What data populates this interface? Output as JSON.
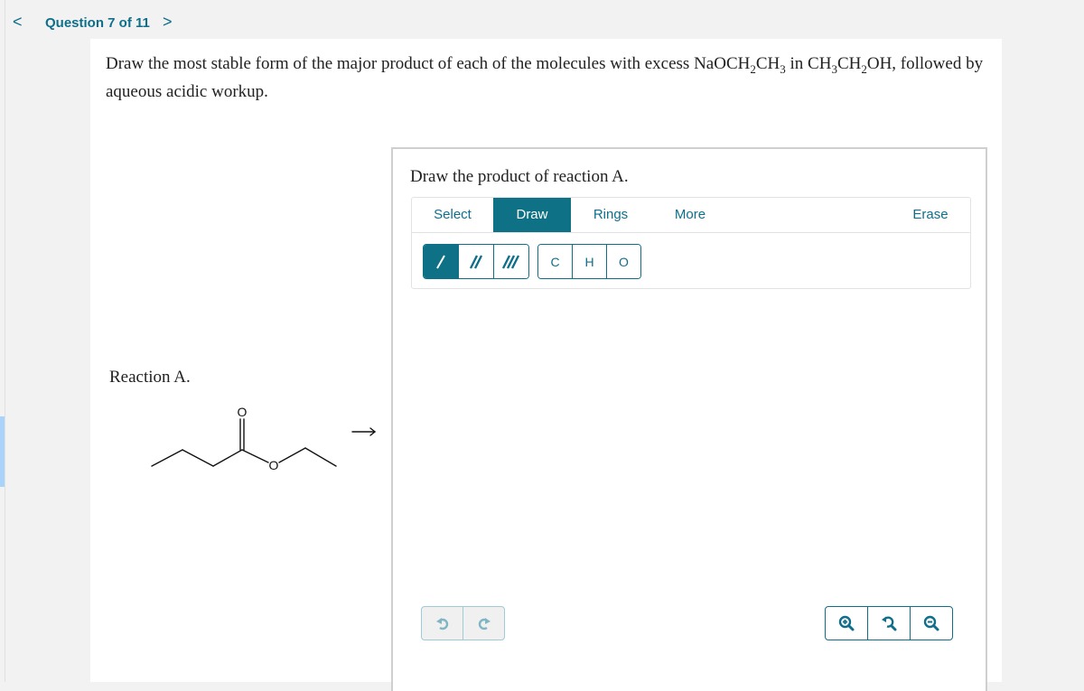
{
  "nav": {
    "prev_icon": "chevron-left-icon",
    "prev_glyph": "<",
    "title": "Question 7 of 11",
    "next_icon": "chevron-right-icon",
    "next_glyph": ">"
  },
  "question": {
    "prompt_parts": {
      "p1": "Draw the most stable form of the major product of each of the molecules with excess NaOCH",
      "s1": "2",
      "p2": "CH",
      "s2": "3",
      "p3": " in CH",
      "s3": "3",
      "p4": "CH",
      "s4": "2",
      "p5": "OH, followed by aqueous acidic workup."
    },
    "reaction_label": "Reaction A.",
    "molecule": {
      "name": "ethyl butanoate",
      "atom_labels": [
        "O",
        "O"
      ],
      "arrow": "reaction-arrow"
    }
  },
  "editor": {
    "title": "Draw the product of reaction A.",
    "tabs": [
      {
        "label": "Select",
        "active": false
      },
      {
        "label": "Draw",
        "active": true
      },
      {
        "label": "Rings",
        "active": false
      },
      {
        "label": "More",
        "active": false
      },
      {
        "label": "Erase",
        "active": false
      }
    ],
    "bond_buttons": [
      {
        "name": "single-bond",
        "active": true
      },
      {
        "name": "double-bond",
        "active": false
      },
      {
        "name": "triple-bond",
        "active": false
      }
    ],
    "atom_buttons": [
      "C",
      "H",
      "O"
    ],
    "history_buttons": [
      "undo-icon",
      "redo-icon"
    ],
    "zoom_buttons": [
      "zoom-in-icon",
      "reset-zoom-icon",
      "zoom-out-icon"
    ]
  },
  "colors": {
    "accent": "#0f7185",
    "link": "#0f6f8a",
    "background": "#f2f2f2",
    "side_accent": "#a9d3fb"
  }
}
